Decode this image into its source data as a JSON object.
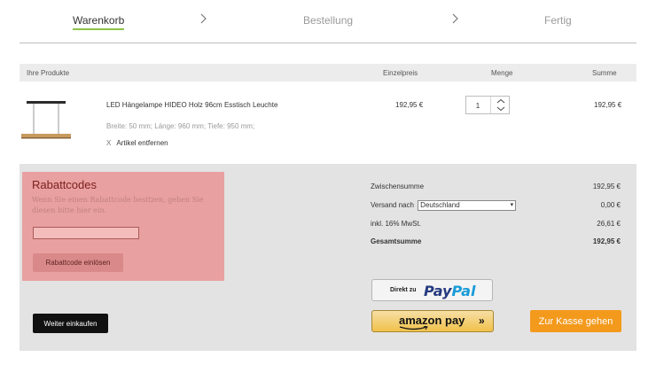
{
  "steps": [
    {
      "label": "Warenkorb",
      "active": true
    },
    {
      "label": "Bestellung",
      "active": false
    },
    {
      "label": "Fertig",
      "active": false
    }
  ],
  "table": {
    "headers": {
      "products": "Ihre Produkte",
      "unit_price": "Einzelpreis",
      "quantity": "Menge",
      "sum": "Summe"
    }
  },
  "item": {
    "name": "LED Hängelampe HIDEO Holz 96cm Esstisch Leuchte",
    "dimensions": "Breite: 50 mm;  Länge: 960 mm;  Tiefe: 950 mm;",
    "remove_icon": "X",
    "remove_label": "Artikel entfernen",
    "unit_price": "192,95 €",
    "quantity": "1",
    "sum": "192,95 €"
  },
  "coupon": {
    "title": "Rabattcodes",
    "text": "Wenn Sie einen Rabattcode besitzen, geben Sie diesen bitte hier ein.",
    "input_value": "",
    "button_label": "Rabattcode einlösen"
  },
  "totals": {
    "subtotal_label": "Zwischensumme",
    "subtotal_value": "192,95 €",
    "shipping_label": "Versand nach",
    "shipping_country": "Deutschland",
    "shipping_value": "0,00 €",
    "tax_label": "inkl. 16% MwSt.",
    "tax_value": "26,61 €",
    "total_label": "Gesamtsumme",
    "total_value": "192,95 €"
  },
  "buttons": {
    "continue_shopping": "Weiter einkaufen",
    "paypal_prefix": "Direkt zu",
    "paypal_brand_1": "Pay",
    "paypal_brand_2": "Pal",
    "amazon_brand": "amazon pay",
    "amazon_arrows": "»",
    "checkout": "Zur Kasse gehen"
  },
  "colors": {
    "accent": "#8bc34a",
    "checkout": "#f39a1d",
    "coupon_bg": "#e9a0a0"
  }
}
